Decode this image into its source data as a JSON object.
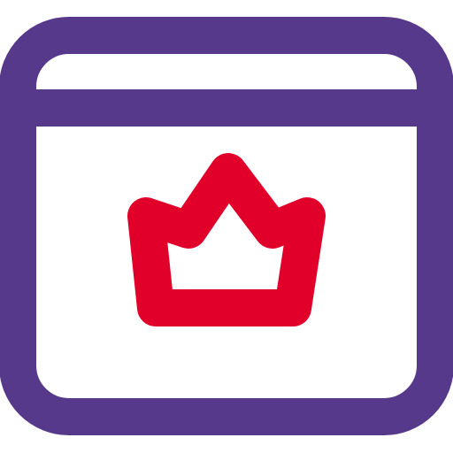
{
  "icon": {
    "name": "browser-window-crown-icon",
    "colors": {
      "window_stroke": "#56398b",
      "crown_stroke": "#e0002a",
      "background": "#ffffff"
    }
  }
}
